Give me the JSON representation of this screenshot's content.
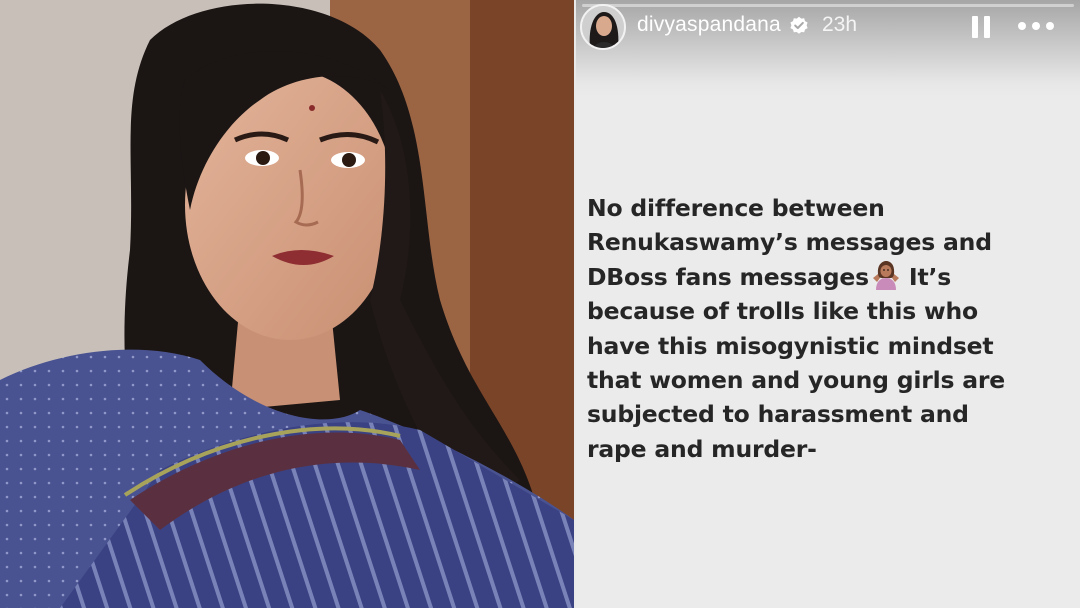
{
  "story": {
    "username": "divyaspandana",
    "time_ago": "23h",
    "progress": 0.0,
    "lines": [
      "No difference between",
      "Renukaswamy’s messages and",
      "DBoss fans messages",
      "because of trolls  like this who",
      "have this misogynistic mindset",
      "that women and young girls are",
      "subjected to harassment and",
      "rape and murder-"
    ],
    "line3_after_emoji": "It’s",
    "emoji_name": "woman-shrugging-emoji"
  },
  "icons": {
    "verified": "verified-badge-icon",
    "pause": "pause-icon",
    "more": "more-options-icon"
  },
  "colors": {
    "text": "#262626",
    "story_bg": "#ebebeb",
    "verified": "#ffffff"
  }
}
